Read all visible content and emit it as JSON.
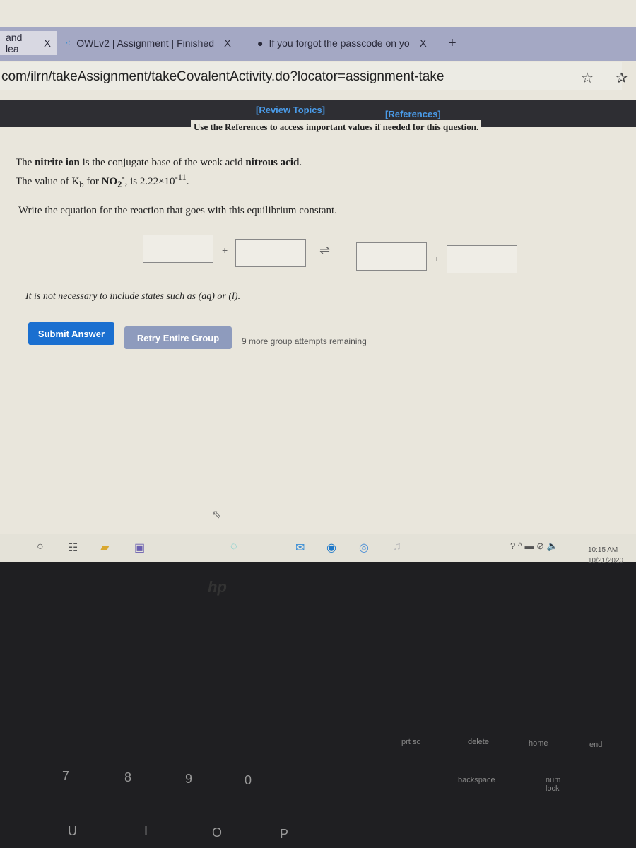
{
  "browser": {
    "tabs": [
      {
        "label": "and lea",
        "icon": "page-icon"
      },
      {
        "label": "OWLv2 | Assignment | Finished",
        "icon": "owl-icon"
      },
      {
        "label": "If you forgot the passcode on yo",
        "icon": "apple-icon"
      }
    ],
    "close_glyph": "X",
    "new_tab": "+",
    "url": "com/ilrn/takeAssignment/takeCovalentActivity.do?locator=assignment-take",
    "star": "☆",
    "favorites": "✰"
  },
  "page": {
    "review_topics": "[Review Topics]",
    "references": "[References]",
    "use_references": "Use the References to access important values if needed for this question.",
    "line1_a": "The ",
    "line1_b": "nitrite ion",
    "line1_c": " is the conjugate base of the weak acid ",
    "line1_d": "nitrous acid",
    "line1_e": ".",
    "line2_a": "The value of K",
    "line2_sub": "b",
    "line2_b": " for ",
    "line2_formula": "NO",
    "line2_formula_sub": "2",
    "line2_formula_sup": "-",
    "line2_c": ", is 2.22×10",
    "line2_exp": "-11",
    "line2_d": ".",
    "instruction": "Write the equation for the reaction that goes with this equilibrium constant.",
    "plus": "+",
    "equilibrium": "⇌",
    "note": "It is not necessary to include states such as (aq) or (l).",
    "submit": "Submit Answer",
    "retry": "Retry Entire Group",
    "attempts": "9 more group attempts remaining"
  },
  "taskbar": {
    "time": "10:15 AM",
    "date": "10/21/2020"
  },
  "keyboard": {
    "brand": "hp",
    "keys": [
      "prt sc",
      "delete",
      "home",
      "end",
      "backspace",
      "num lock",
      "8",
      "9",
      "0",
      "7",
      "U",
      "I",
      "O",
      "P"
    ]
  },
  "colors": {
    "submit": "#1a6fd0",
    "retry": "#8e9bbd",
    "link": "#4a9be8"
  }
}
